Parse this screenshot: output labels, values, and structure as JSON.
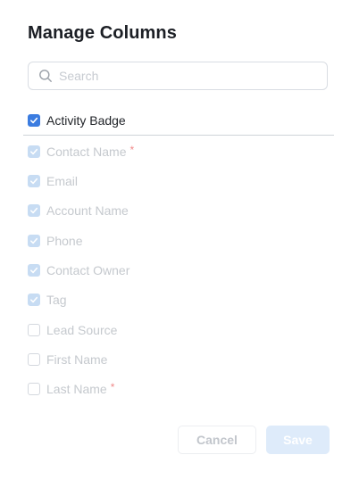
{
  "dialog": {
    "title": "Manage Columns",
    "search": {
      "placeholder": "Search",
      "value": ""
    },
    "columns": [
      {
        "label": "Activity Badge",
        "checked": true,
        "disabled": false,
        "required": false
      },
      {
        "label": "Contact Name",
        "checked": true,
        "disabled": true,
        "required": true
      },
      {
        "label": "Email",
        "checked": true,
        "disabled": true,
        "required": false
      },
      {
        "label": "Account Name",
        "checked": true,
        "disabled": true,
        "required": false
      },
      {
        "label": "Phone",
        "checked": true,
        "disabled": true,
        "required": false
      },
      {
        "label": "Contact Owner",
        "checked": true,
        "disabled": true,
        "required": false
      },
      {
        "label": "Tag",
        "checked": true,
        "disabled": true,
        "required": false
      },
      {
        "label": "Lead Source",
        "checked": false,
        "disabled": true,
        "required": false
      },
      {
        "label": "First Name",
        "checked": false,
        "disabled": true,
        "required": false
      },
      {
        "label": "Last Name",
        "checked": false,
        "disabled": true,
        "required": true
      }
    ],
    "required_marker": "*",
    "buttons": {
      "cancel": "Cancel",
      "save": "Save"
    }
  },
  "colors": {
    "accent": "#3b7ce0",
    "checkbox_disabled": "#c7dcf3",
    "save_disabled_bg": "#deebfa",
    "required_marker": "#f08a8a"
  }
}
